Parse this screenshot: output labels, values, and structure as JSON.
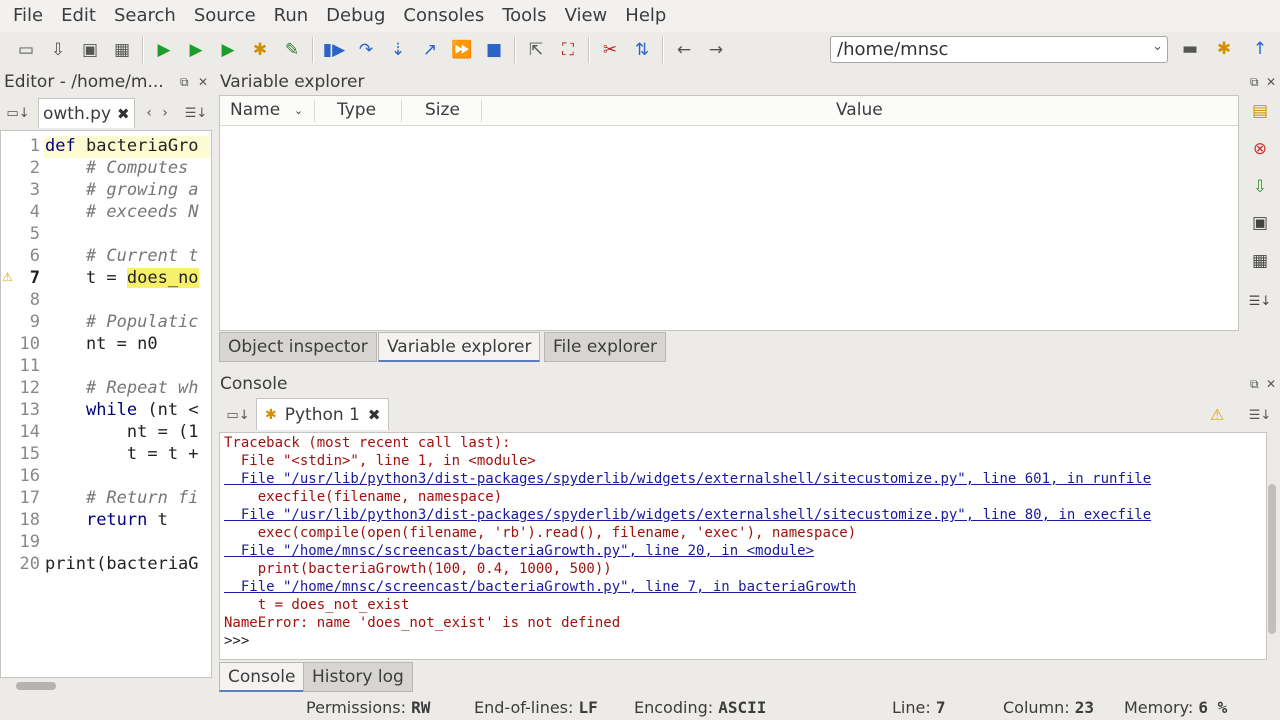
{
  "menubar": {
    "items": [
      "File",
      "Edit",
      "Search",
      "Source",
      "Run",
      "Debug",
      "Consoles",
      "Tools",
      "View",
      "Help"
    ]
  },
  "toolbar": {
    "icons": [
      "new-file-icon",
      "open-file-icon",
      "save-icon",
      "save-all-icon",
      "run-icon",
      "run-file-icon",
      "run-selection-icon",
      "debug-icon",
      "debug-step-icon",
      "debug-continue-icon",
      "step-over-icon",
      "step-into-icon",
      "step-return-icon",
      "continue-icon",
      "stop-icon",
      "maximize-icon",
      "fullscreen-icon",
      "tools-icon",
      "python-path-icon",
      "back-arrow-icon",
      "forward-arrow-icon"
    ],
    "path": "/home/mnsc"
  },
  "editor": {
    "title": "Editor - /home/m...",
    "tab_label": "owth.py",
    "lines": [
      {
        "n": "1",
        "text": "def bacteriaGro"
      },
      {
        "n": "2",
        "text": "    # Computes "
      },
      {
        "n": "3",
        "text": "    # growing a"
      },
      {
        "n": "4",
        "text": "    # exceeds N"
      },
      {
        "n": "5",
        "text": ""
      },
      {
        "n": "6",
        "text": "    # Current t"
      },
      {
        "n": "7",
        "text": "    t = does_no"
      },
      {
        "n": "8",
        "text": ""
      },
      {
        "n": "9",
        "text": "    # Populatic"
      },
      {
        "n": "10",
        "text": "    nt = n0"
      },
      {
        "n": "11",
        "text": ""
      },
      {
        "n": "12",
        "text": "    # Repeat wh"
      },
      {
        "n": "13",
        "text": "    while (nt <"
      },
      {
        "n": "14",
        "text": "        nt = (1"
      },
      {
        "n": "15",
        "text": "        t = t +"
      },
      {
        "n": "16",
        "text": ""
      },
      {
        "n": "17",
        "text": "    # Return fi"
      },
      {
        "n": "18",
        "text": "    return t"
      },
      {
        "n": "19",
        "text": ""
      },
      {
        "n": "20",
        "text": "print(bacteriaG"
      }
    ]
  },
  "variable_explorer": {
    "title": "Variable explorer",
    "columns": [
      "Name",
      "Type",
      "Size",
      "Value"
    ],
    "tabs": [
      "Object inspector",
      "Variable explorer",
      "File explorer"
    ]
  },
  "console": {
    "title": "Console",
    "tab_label": "Python 1",
    "lines": [
      {
        "cls": "err",
        "text": "Traceback (most recent call last):"
      },
      {
        "cls": "err",
        "text": "  File \"<stdin>\", line 1, in <module>"
      },
      {
        "cls": "lnk",
        "text": "  File \"/usr/lib/python3/dist-packages/spyderlib/widgets/externalshell/sitecustomize.py\", line 601, in runfile"
      },
      {
        "cls": "err",
        "text": "    execfile(filename, namespace)"
      },
      {
        "cls": "lnk",
        "text": "  File \"/usr/lib/python3/dist-packages/spyderlib/widgets/externalshell/sitecustomize.py\", line 80, in execfile"
      },
      {
        "cls": "err",
        "text": "    exec(compile(open(filename, 'rb').read(), filename, 'exec'), namespace)"
      },
      {
        "cls": "lnk",
        "text": "  File \"/home/mnsc/screencast/bacteriaGrowth.py\", line 20, in <module>"
      },
      {
        "cls": "err",
        "text": "    print(bacteriaGrowth(100, 0.4, 1000, 500))"
      },
      {
        "cls": "lnk",
        "text": "  File \"/home/mnsc/screencast/bacteriaGrowth.py\", line 7, in bacteriaGrowth"
      },
      {
        "cls": "err",
        "text": "    t = does_not_exist"
      },
      {
        "cls": "err",
        "text": "NameError: name 'does_not_exist' is not defined"
      },
      {
        "cls": "prm",
        "text": ">>> "
      }
    ],
    "tabs": [
      "Console",
      "History log"
    ]
  },
  "statusbar": {
    "permissions_label": "Permissions:",
    "permissions_value": "RW",
    "eol_label": "End-of-lines:",
    "eol_value": "LF",
    "encoding_label": "Encoding:",
    "encoding_value": "ASCII",
    "line_label": "Line:",
    "line_value": "7",
    "column_label": "Column:",
    "column_value": "23",
    "memory_label": "Memory:",
    "memory_value": "6 %"
  }
}
